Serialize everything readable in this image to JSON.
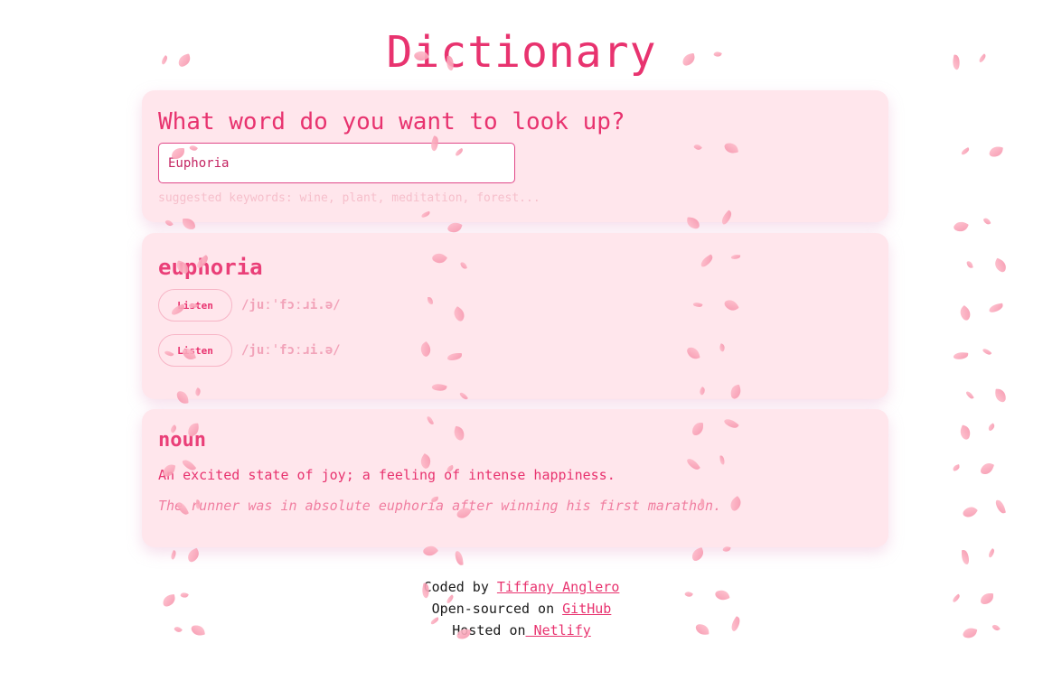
{
  "app": {
    "title": "Dictionary"
  },
  "search": {
    "heading": "What word do you want to look up?",
    "value": "Euphoria",
    "hint": "suggested keywords: wine, plant, meditation, forest..."
  },
  "word": {
    "title": "euphoria",
    "phonetics": [
      {
        "button_label": "Listen",
        "text": "/juːˈfɔːɹi.ə/"
      },
      {
        "button_label": "Listen",
        "text": "/juːˈfɔːɹi.ə/"
      }
    ]
  },
  "meaning": {
    "part_of_speech": "noun",
    "definition": "An excited state of joy; a feeling of intense happiness.",
    "example": "The runner was in absolute euphoria after winning his first marathon."
  },
  "footer": {
    "coded_prefix": "Coded by ",
    "coded_link": "Tiffany Anglero",
    "open_prefix": "Open-sourced on ",
    "open_link": "GitHub",
    "hosted_prefix": "Hosted on",
    "hosted_link": " Netlify"
  },
  "colors": {
    "accent": "#e8336f",
    "card_bg": "#ffe6ec",
    "petal": "#f58fa8"
  }
}
